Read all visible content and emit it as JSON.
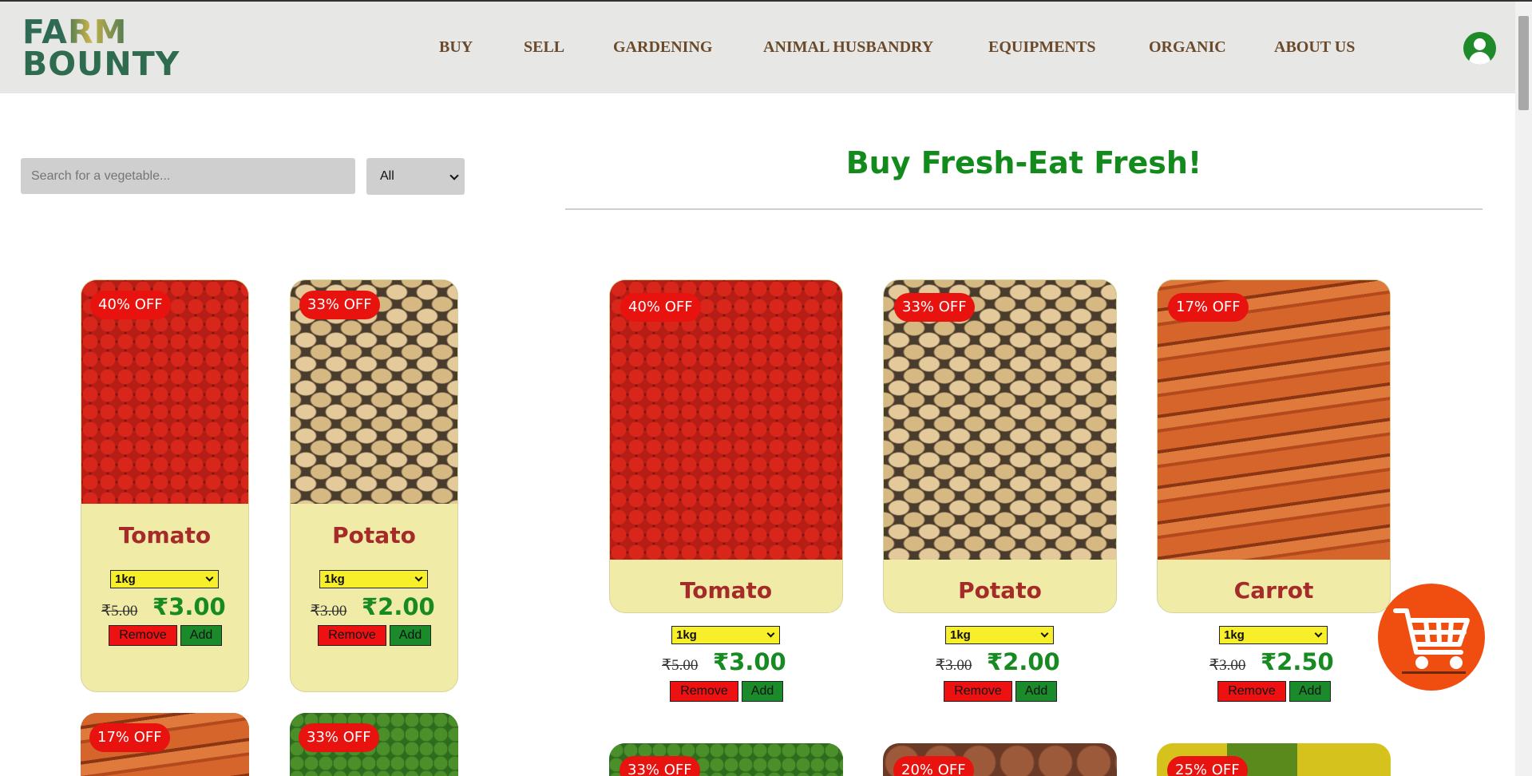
{
  "brand": {
    "line1": "FARM",
    "line2": "BOUNTY"
  },
  "nav": {
    "items": [
      {
        "label": "BUY"
      },
      {
        "label": "SELL"
      },
      {
        "label": "GARDENING"
      },
      {
        "label": "ANIMAL HUSBANDRY"
      },
      {
        "label": "EQUIPMENTS"
      },
      {
        "label": "ORGANIC"
      },
      {
        "label": "ABOUT US"
      }
    ]
  },
  "search": {
    "placeholder": "Search for a vegetable...",
    "filter_value": "All"
  },
  "main": {
    "title": "Buy Fresh-Eat Fresh!"
  },
  "left_products": [
    {
      "name": "Tomato",
      "badge": "40% OFF",
      "qty": "1kg",
      "old_price": "₹5.00",
      "new_price": "₹3.00",
      "remove": "Remove",
      "add": "Add"
    },
    {
      "name": "Potato",
      "badge": "33% OFF",
      "qty": "1kg",
      "old_price": "₹3.00",
      "new_price": "₹2.00",
      "remove": "Remove",
      "add": "Add"
    }
  ],
  "left_partial": [
    {
      "badge": "17% OFF"
    },
    {
      "badge": "33% OFF"
    }
  ],
  "products": [
    {
      "name": "Tomato",
      "badge": "40% OFF",
      "qty": "1kg",
      "old_price": "₹5.00",
      "new_price": "₹3.00",
      "remove": "Remove",
      "add": "Add"
    },
    {
      "name": "Potato",
      "badge": "33% OFF",
      "qty": "1kg",
      "old_price": "₹3.00",
      "new_price": "₹2.00",
      "remove": "Remove",
      "add": "Add"
    },
    {
      "name": "Carrot",
      "badge": "17% OFF",
      "qty": "1kg",
      "old_price": "₹3.00",
      "new_price": "₹2.50",
      "remove": "Remove",
      "add": "Add"
    }
  ],
  "products_partial": [
    {
      "badge": "33% OFF"
    },
    {
      "badge": "20% OFF"
    },
    {
      "badge": "25% OFF"
    }
  ],
  "colors": {
    "header_bg": "#e7e7e5",
    "nav_text": "#6b4a2b",
    "card_bg": "#f0eba6",
    "price_green": "#178a21",
    "product_name": "#a52a2a",
    "badge_red": "#e8130f",
    "cart_orange": "#f04d10"
  },
  "icons": {
    "user": "user-icon",
    "cart": "shopping-cart-icon"
  }
}
